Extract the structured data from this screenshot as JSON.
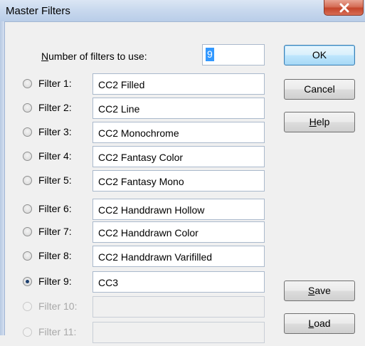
{
  "window": {
    "title": "Master Filters",
    "close_symbol": "X"
  },
  "num_filters": {
    "label_underlined": "N",
    "label_rest": "umber of filters to use:",
    "value": "9"
  },
  "filters": [
    {
      "label": "Filter 1:",
      "value": "CC2 Filled",
      "selected": false,
      "enabled": true
    },
    {
      "label": "Filter 2:",
      "value": "CC2 Line",
      "selected": false,
      "enabled": true
    },
    {
      "label": "Filter 3:",
      "value": "CC2 Monochrome",
      "selected": false,
      "enabled": true
    },
    {
      "label": "Filter 4:",
      "value": "CC2 Fantasy Color",
      "selected": false,
      "enabled": true
    },
    {
      "label": "Filter 5:",
      "value": "CC2 Fantasy Mono",
      "selected": false,
      "enabled": true
    },
    {
      "label": "Filter 6:",
      "value": "CC2 Handdrawn Hollow",
      "selected": false,
      "enabled": true
    },
    {
      "label": "Filter 7:",
      "value": "CC2 Handdrawn Color",
      "selected": false,
      "enabled": true
    },
    {
      "label": "Filter 8:",
      "value": "CC2 Handdrawn Varifilled",
      "selected": false,
      "enabled": true
    },
    {
      "label": "Filter 9:",
      "value": "CC3",
      "selected": true,
      "enabled": true
    },
    {
      "label": "Filter 10:",
      "value": "",
      "selected": false,
      "enabled": false
    },
    {
      "label": "Filter 11:",
      "value": "",
      "selected": false,
      "enabled": false
    }
  ],
  "buttons": {
    "ok": "OK",
    "cancel": "Cancel",
    "help_underlined": "H",
    "help_rest": "elp",
    "save_underlined": "S",
    "save_rest": "ave",
    "load_underlined": "L",
    "load_rest": "oad"
  },
  "colors": {
    "selection": "#3399ff",
    "default_button_border": "#3c7fb1",
    "close_button": "#c4462b"
  }
}
